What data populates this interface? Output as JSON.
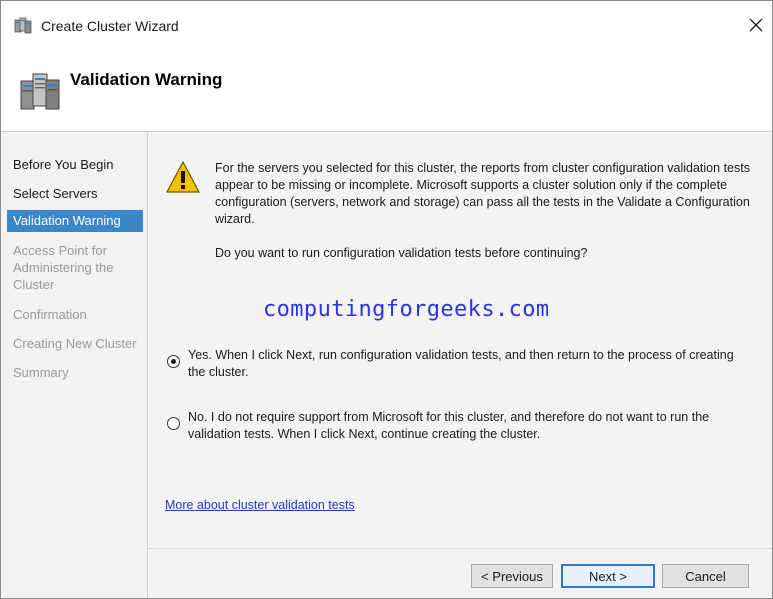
{
  "window": {
    "title": "Create Cluster Wizard",
    "close_glyph": "✕",
    "title_icon": "cluster-wizard-icon",
    "close_icon": "close-icon"
  },
  "header": {
    "title": "Validation Warning",
    "icon": "server-cluster-icon"
  },
  "sidebar": {
    "steps": [
      {
        "label": "Before You Begin",
        "state": "enabled"
      },
      {
        "label": "Select Servers",
        "state": "enabled"
      },
      {
        "label": "Validation Warning",
        "state": "active"
      },
      {
        "label": "Access Point for Administering the Cluster",
        "state": "disabled"
      },
      {
        "label": "Confirmation",
        "state": "disabled"
      },
      {
        "label": "Creating New Cluster",
        "state": "disabled"
      },
      {
        "label": "Summary",
        "state": "disabled"
      }
    ]
  },
  "main": {
    "warning_icon": "warning-icon",
    "warning_text": "For the servers you selected for this cluster, the reports from cluster configuration validation tests appear to be missing or incomplete.  Microsoft supports a cluster solution only if the complete configuration (servers, network and storage) can pass all the tests in the Validate a Configuration wizard.",
    "question": "Do you want to run configuration validation tests before continuing?",
    "watermark": "computingforgeeks.com",
    "options": [
      {
        "label": "Yes.  When I click Next, run configuration validation tests, and then return to the process of creating the cluster.",
        "selected": true
      },
      {
        "label": "No.  I do not require support from Microsoft for this cluster, and therefore do not want to run the validation tests.  When I click Next, continue creating the cluster.",
        "selected": false
      }
    ],
    "link": "More about cluster validation tests"
  },
  "footer": {
    "previous_label": "< Previous",
    "next_label": "Next >",
    "cancel_label": "Cancel"
  },
  "colors": {
    "accent": "#3a86c8",
    "link": "#1f3fb5",
    "watermark": "#2b33e8",
    "warning": "#f2c200"
  }
}
